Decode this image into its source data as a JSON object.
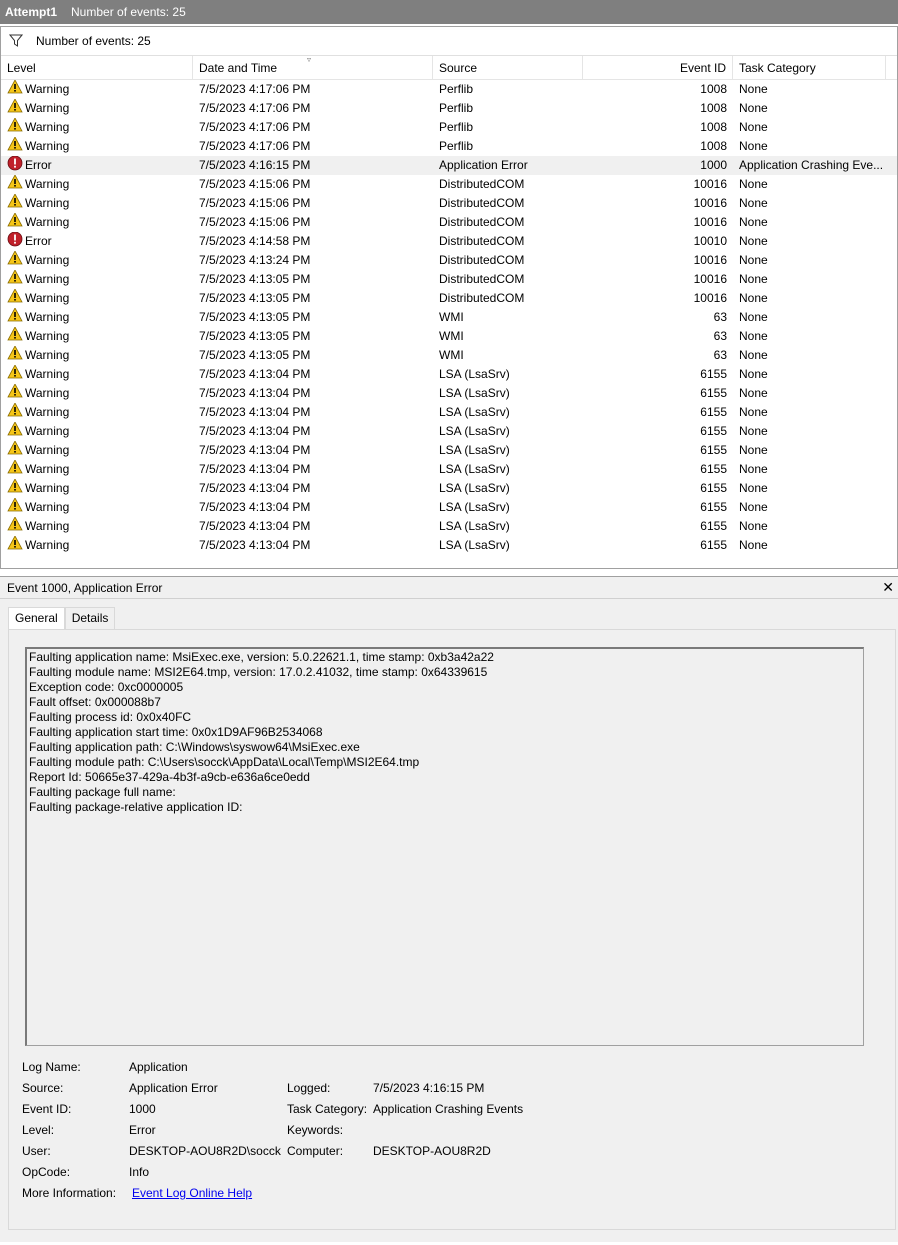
{
  "window": {
    "title": "Attempt1",
    "event_count_text": "Number of events: 25"
  },
  "filter": {
    "icon": "filter-icon",
    "count_text": "Number of events: 25"
  },
  "columns": {
    "level": "Level",
    "date": "Date and Time",
    "source": "Source",
    "event_id": "Event ID",
    "task_category": "Task Category"
  },
  "colors": {
    "warning": "#f5c518",
    "error": "#c0202a",
    "titlebar": "#7f7f7f",
    "link": "#0000ee"
  },
  "events": [
    {
      "level": "Warning",
      "date": "7/5/2023 4:17:06 PM",
      "source": "Perflib",
      "event_id": "1008",
      "task_category": "None"
    },
    {
      "level": "Warning",
      "date": "7/5/2023 4:17:06 PM",
      "source": "Perflib",
      "event_id": "1008",
      "task_category": "None"
    },
    {
      "level": "Warning",
      "date": "7/5/2023 4:17:06 PM",
      "source": "Perflib",
      "event_id": "1008",
      "task_category": "None"
    },
    {
      "level": "Warning",
      "date": "7/5/2023 4:17:06 PM",
      "source": "Perflib",
      "event_id": "1008",
      "task_category": "None"
    },
    {
      "level": "Error",
      "date": "7/5/2023 4:16:15 PM",
      "source": "Application Error",
      "event_id": "1000",
      "task_category": "Application Crashing Eve...",
      "selected": true
    },
    {
      "level": "Warning",
      "date": "7/5/2023 4:15:06 PM",
      "source": "DistributedCOM",
      "event_id": "10016",
      "task_category": "None"
    },
    {
      "level": "Warning",
      "date": "7/5/2023 4:15:06 PM",
      "source": "DistributedCOM",
      "event_id": "10016",
      "task_category": "None"
    },
    {
      "level": "Warning",
      "date": "7/5/2023 4:15:06 PM",
      "source": "DistributedCOM",
      "event_id": "10016",
      "task_category": "None"
    },
    {
      "level": "Error",
      "date": "7/5/2023 4:14:58 PM",
      "source": "DistributedCOM",
      "event_id": "10010",
      "task_category": "None"
    },
    {
      "level": "Warning",
      "date": "7/5/2023 4:13:24 PM",
      "source": "DistributedCOM",
      "event_id": "10016",
      "task_category": "None"
    },
    {
      "level": "Warning",
      "date": "7/5/2023 4:13:05 PM",
      "source": "DistributedCOM",
      "event_id": "10016",
      "task_category": "None"
    },
    {
      "level": "Warning",
      "date": "7/5/2023 4:13:05 PM",
      "source": "DistributedCOM",
      "event_id": "10016",
      "task_category": "None"
    },
    {
      "level": "Warning",
      "date": "7/5/2023 4:13:05 PM",
      "source": "WMI",
      "event_id": "63",
      "task_category": "None"
    },
    {
      "level": "Warning",
      "date": "7/5/2023 4:13:05 PM",
      "source": "WMI",
      "event_id": "63",
      "task_category": "None"
    },
    {
      "level": "Warning",
      "date": "7/5/2023 4:13:05 PM",
      "source": "WMI",
      "event_id": "63",
      "task_category": "None"
    },
    {
      "level": "Warning",
      "date": "7/5/2023 4:13:04 PM",
      "source": "LSA (LsaSrv)",
      "event_id": "6155",
      "task_category": "None"
    },
    {
      "level": "Warning",
      "date": "7/5/2023 4:13:04 PM",
      "source": "LSA (LsaSrv)",
      "event_id": "6155",
      "task_category": "None"
    },
    {
      "level": "Warning",
      "date": "7/5/2023 4:13:04 PM",
      "source": "LSA (LsaSrv)",
      "event_id": "6155",
      "task_category": "None"
    },
    {
      "level": "Warning",
      "date": "7/5/2023 4:13:04 PM",
      "source": "LSA (LsaSrv)",
      "event_id": "6155",
      "task_category": "None"
    },
    {
      "level": "Warning",
      "date": "7/5/2023 4:13:04 PM",
      "source": "LSA (LsaSrv)",
      "event_id": "6155",
      "task_category": "None"
    },
    {
      "level": "Warning",
      "date": "7/5/2023 4:13:04 PM",
      "source": "LSA (LsaSrv)",
      "event_id": "6155",
      "task_category": "None"
    },
    {
      "level": "Warning",
      "date": "7/5/2023 4:13:04 PM",
      "source": "LSA (LsaSrv)",
      "event_id": "6155",
      "task_category": "None"
    },
    {
      "level": "Warning",
      "date": "7/5/2023 4:13:04 PM",
      "source": "LSA (LsaSrv)",
      "event_id": "6155",
      "task_category": "None"
    },
    {
      "level": "Warning",
      "date": "7/5/2023 4:13:04 PM",
      "source": "LSA (LsaSrv)",
      "event_id": "6155",
      "task_category": "None"
    },
    {
      "level": "Warning",
      "date": "7/5/2023 4:13:04 PM",
      "source": "LSA (LsaSrv)",
      "event_id": "6155",
      "task_category": "None"
    }
  ],
  "detail": {
    "header": "Event 1000, Application Error",
    "close_icon": "close-icon",
    "tabs": [
      "General",
      "Details"
    ],
    "description_lines": [
      "Faulting application name: MsiExec.exe, version: 5.0.22621.1, time stamp: 0xb3a42a22",
      "Faulting module name: MSI2E64.tmp, version: 17.0.2.41032, time stamp: 0x64339615",
      "Exception code: 0xc0000005",
      "Fault offset: 0x000088b7",
      "Faulting process id: 0x0x40FC",
      "Faulting application start time: 0x0x1D9AF96B2534068",
      "Faulting application path: C:\\Windows\\syswow64\\MsiExec.exe",
      "Faulting module path: C:\\Users\\socck\\AppData\\Local\\Temp\\MSI2E64.tmp",
      "Report Id: 50665e37-429a-4b3f-a9cb-e636a6ce0edd",
      "Faulting package full name:",
      "Faulting package-relative application ID:"
    ],
    "props": {
      "log_name_label": "Log Name:",
      "log_name": "Application",
      "source_label": "Source:",
      "source": "Application Error",
      "logged_label": "Logged:",
      "logged": "7/5/2023 4:16:15 PM",
      "event_id_label": "Event ID:",
      "event_id": "1000",
      "task_category_label": "Task Category:",
      "task_category": "Application Crashing Events",
      "level_label": "Level:",
      "level": "Error",
      "keywords_label": "Keywords:",
      "keywords": "",
      "user_label": "User:",
      "user": "DESKTOP-AOU8R2D\\socck",
      "computer_label": "Computer:",
      "computer": "DESKTOP-AOU8R2D",
      "opcode_label": "OpCode:",
      "opcode": "Info",
      "more_info_label": "More Information:",
      "more_info_link": "Event Log Online Help"
    }
  }
}
